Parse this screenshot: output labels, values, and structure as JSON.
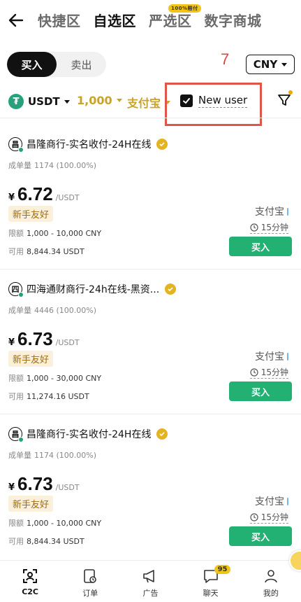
{
  "header": {
    "tabs": [
      {
        "label": "快捷区",
        "active": false
      },
      {
        "label": "自选区",
        "active": true
      },
      {
        "label": "严选区",
        "active": false,
        "badge": "100%赔付"
      },
      {
        "label": "数字商城",
        "active": false
      }
    ]
  },
  "trade_toggle": {
    "buy": "买入",
    "sell": "卖出",
    "selected": "buy"
  },
  "annotation": "7",
  "currency": "CNY",
  "filters": {
    "coin": "USDT",
    "amount": "1,000",
    "payment": "支付宝",
    "new_user_label": "New user",
    "new_user_checked": true
  },
  "listings": [
    {
      "avatar": "昌",
      "merchant": "昌隆商行-实名收付-24H在线",
      "orders_label": "成单量",
      "orders": "1174 (100.00%)",
      "currency_symbol": "¥",
      "price": "6.72",
      "unit": "/USDT",
      "tag": "新手友好",
      "limit_label": "限额",
      "limit": "1,000 - 10,000 CNY",
      "available_label": "可用",
      "available": "8,844.34 USDT",
      "payment": "支付宝",
      "time": "15分钟",
      "buy_label": "买入"
    },
    {
      "avatar": "四",
      "merchant": "四海通财商行-24h在线-黑资...",
      "orders_label": "成单量",
      "orders": "4446 (100.00%)",
      "currency_symbol": "¥",
      "price": "6.73",
      "unit": "/USDT",
      "tag": "新手友好",
      "limit_label": "限额",
      "limit": "1,000 - 30,000 CNY",
      "available_label": "可用",
      "available": "11,274.16 USDT",
      "payment": "支付宝",
      "time": "15分钟",
      "buy_label": "买入"
    },
    {
      "avatar": "昌",
      "merchant": "昌隆商行-实名收付-24H在线",
      "orders_label": "成单量",
      "orders": "1174 (100.00%)",
      "currency_symbol": "¥",
      "price": "6.73",
      "unit": "/USDT",
      "tag": "新手友好",
      "limit_label": "限额",
      "limit": "1,000 - 10,000 CNY",
      "available_label": "可用",
      "available": "8,844.34 USDT",
      "payment": "支付宝",
      "time": "15分钟",
      "buy_label": "买入"
    }
  ],
  "bottom_nav": [
    {
      "label": "C2C",
      "icon": "c2c-icon",
      "active": true
    },
    {
      "label": "订单",
      "icon": "order-icon",
      "active": false
    },
    {
      "label": "广告",
      "icon": "megaphone-icon",
      "active": false
    },
    {
      "label": "聊天",
      "icon": "chat-icon",
      "active": false,
      "badge": "95"
    },
    {
      "label": "我的",
      "icon": "profile-icon",
      "active": false
    }
  ],
  "colors": {
    "accent_gold": "#c9a227",
    "buy_green": "#22b173",
    "highlight_red": "#e05548",
    "tag_bg": "#fbf0db"
  }
}
